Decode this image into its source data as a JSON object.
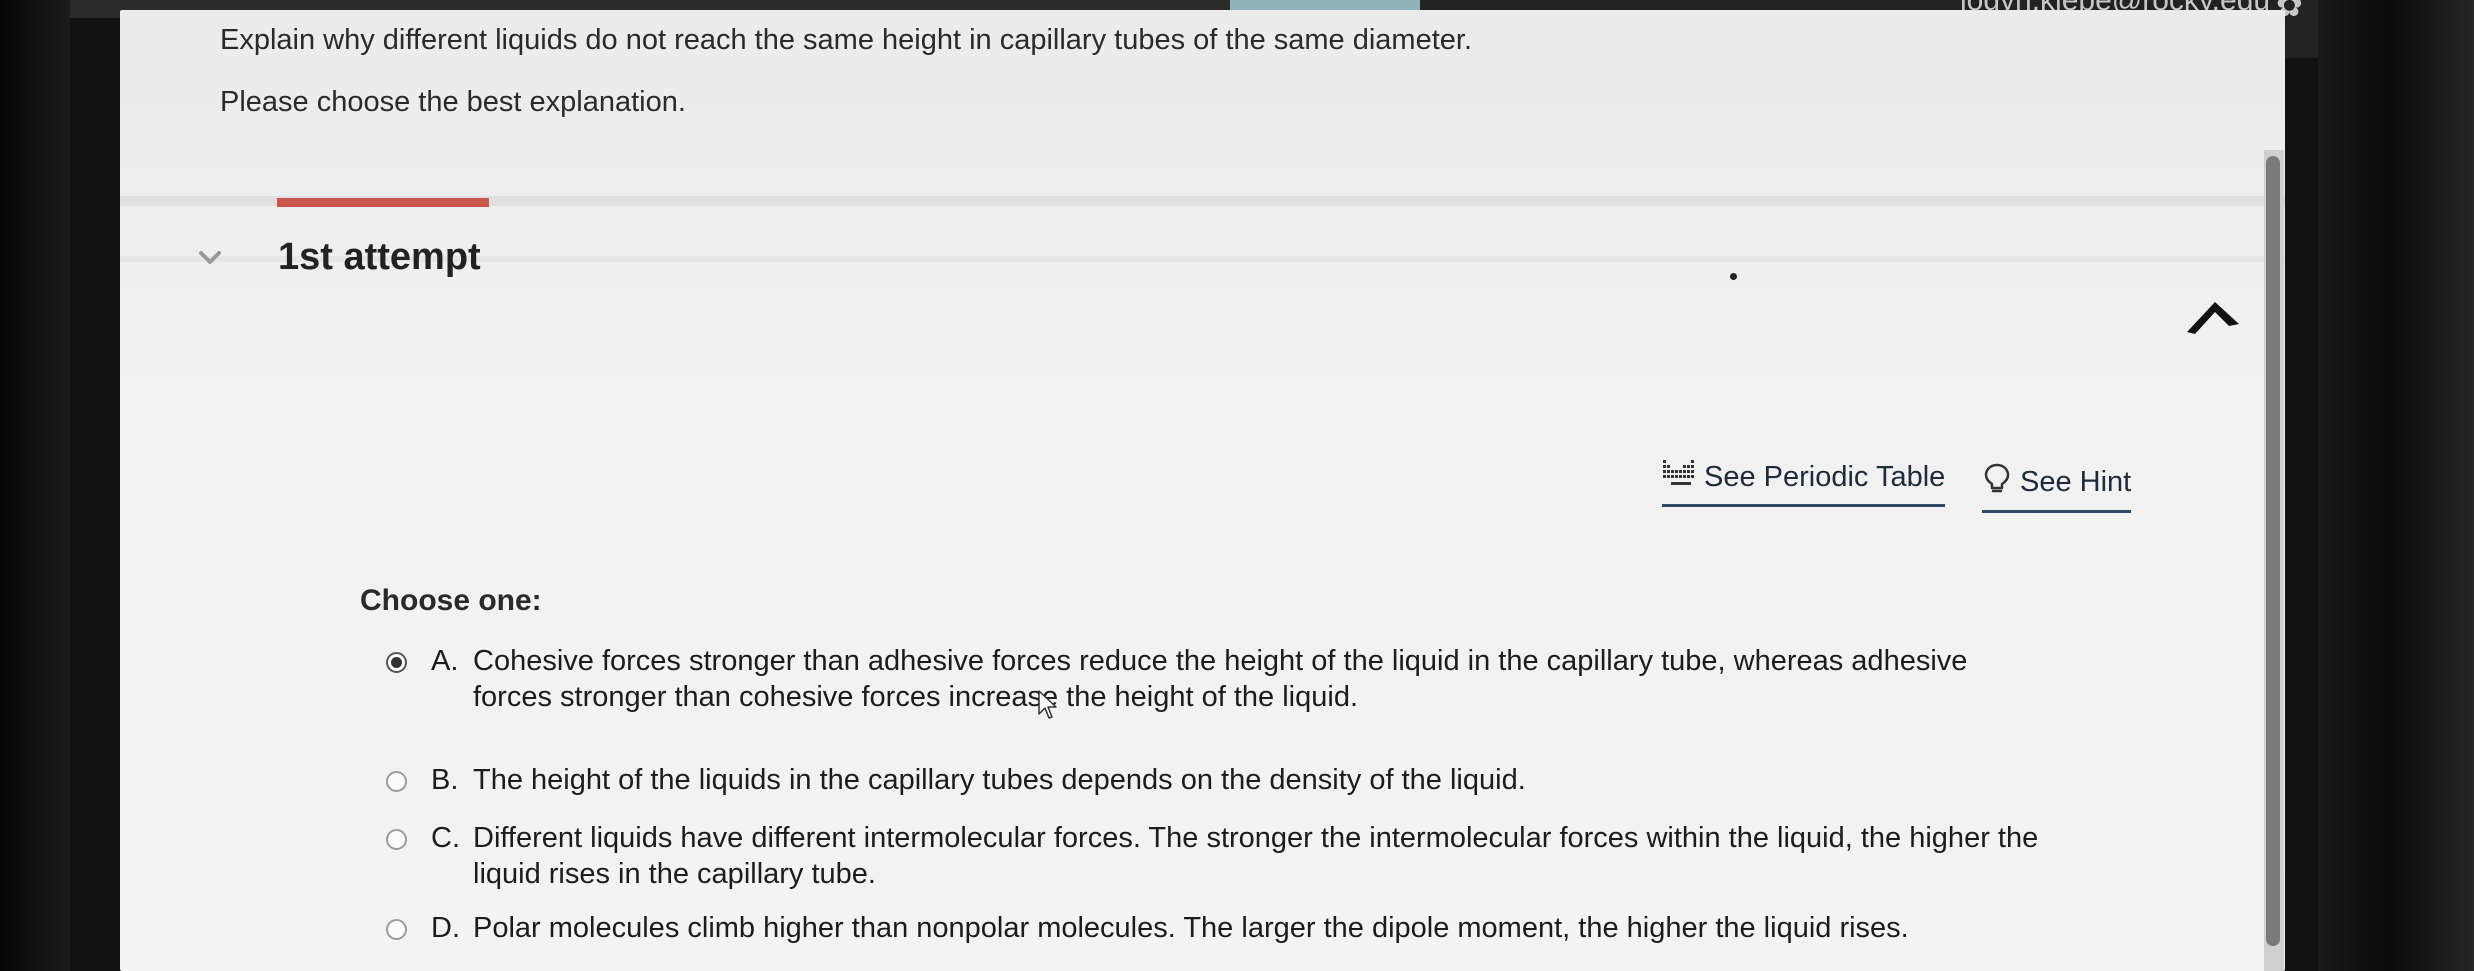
{
  "header": {
    "user_email": "logyn.klebe@rocky.edu",
    "gear_icon": "gear-icon"
  },
  "question": {
    "prompt": "Explain why different liquids do not reach the same height in capillary tubes of the same diameter.",
    "instruction": "Please choose the best explanation."
  },
  "attempt": {
    "title": "1st attempt",
    "toggle_icon": "chevron-down-icon",
    "collapse_icon": "collapse-arrow-icon"
  },
  "tools": {
    "periodic_table_label": "See Periodic Table",
    "periodic_table_icon": "periodic-table-icon",
    "hint_label": "See Hint",
    "hint_icon": "lightbulb-icon"
  },
  "choices": {
    "label": "Choose one:",
    "selected": "A",
    "options": [
      {
        "letter": "A.",
        "text": "Cohesive forces stronger than adhesive forces reduce the height of the liquid in the capillary tube, whereas adhesive forces stronger than cohesive forces increase the height of the liquid."
      },
      {
        "letter": "B.",
        "text": "The height of the liquids in the capillary tubes depends on the density of the liquid."
      },
      {
        "letter": "C.",
        "text": "Different liquids have different intermolecular forces. The stronger the intermolecular forces within the liquid, the higher the liquid rises in the capillary tube."
      },
      {
        "letter": "D.",
        "text": "Polar molecules climb higher than nonpolar molecules. The larger the dipole moment, the higher the liquid rises."
      }
    ]
  },
  "colors": {
    "progress_accent": "#c8574e",
    "link_underline": "#2f4a63",
    "tab_accent": "#8fb3b9"
  }
}
